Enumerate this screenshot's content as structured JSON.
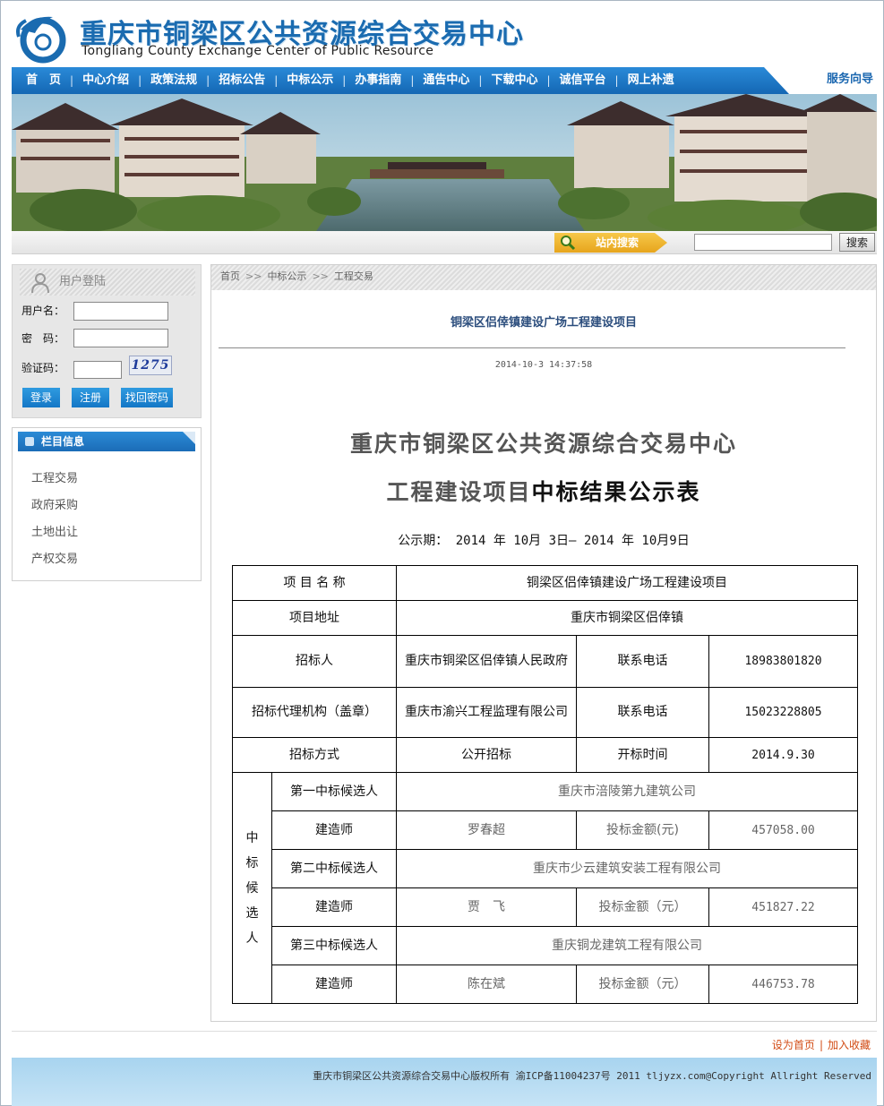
{
  "header": {
    "title": "重庆市铜梁区公共资源综合交易中心",
    "subtitle": "Tongliang County Exchange Center of Public Resource"
  },
  "nav": {
    "items": [
      "首　页",
      "中心介绍",
      "政策法规",
      "招标公告",
      "中标公示",
      "办事指南",
      "通告中心",
      "下载中心",
      "诚信平台",
      "网上补遗"
    ],
    "service": "服务向导"
  },
  "search": {
    "tag_label": "站内搜索",
    "placeholder": "",
    "button": "搜索"
  },
  "login": {
    "title": "用户登陆",
    "username_label": "用户名：",
    "password_label": "密　码：",
    "captcha_label": "验证码：",
    "captcha_value": "1275",
    "login_btn": "登录",
    "register_btn": "注册",
    "recover_btn": "找回密码"
  },
  "column_info": {
    "title": "栏目信息",
    "items": [
      "工程交易",
      "政府采购",
      "土地出让",
      "产权交易"
    ]
  },
  "breadcrumb": [
    "首页",
    "中标公示",
    "工程交易"
  ],
  "article": {
    "title": "铜梁区侣倖镇建设广场工程建设项目",
    "date": "2014-10-3 14:37:58",
    "doc_title1": "重庆市铜梁区公共资源综合交易中心",
    "doc_title2a": "工程建设项目",
    "doc_title2b": "中标结果公示表",
    "period": "公示期：  2014 年 10月 3日—  2014 年 10月9日"
  },
  "table": {
    "project_name_label": "项 目 名 称",
    "project_name": "铜梁区侣倖镇建设广场工程建设项目",
    "address_label": "项目地址",
    "address": "重庆市铜梁区侣倖镇",
    "tenderer_label": "招标人",
    "tenderer": "重庆市铜梁区侣倖镇人民政府",
    "phone_label": "联系电话",
    "tenderer_phone": "18983801820",
    "agency_label": "招标代理机构（盖章）",
    "agency": "重庆市渝兴工程监理有限公司",
    "agency_phone": "15023228805",
    "method_label": "招标方式",
    "method": "公开招标",
    "open_time_label": "开标时间",
    "open_time": "2014.9.30",
    "candidates_label_chars": [
      "中",
      "标",
      "候",
      "选",
      "人"
    ],
    "candidates": [
      {
        "rank_label": "第一中标候选人",
        "company": "重庆市涪陵第九建筑公司",
        "builder_label": "建造师",
        "builder": "罗春超",
        "amount_label": "投标金额(元)",
        "amount": "457058.00"
      },
      {
        "rank_label": "第二中标候选人",
        "company": "重庆市少云建筑安装工程有限公司",
        "builder_label": "建造师",
        "builder": "贾　飞",
        "amount_label": "投标金额（元）",
        "amount": "451827.22"
      },
      {
        "rank_label": "第三中标候选人",
        "company": "重庆铜龙建筑工程有限公司",
        "builder_label": "建造师",
        "builder": "陈在斌",
        "amount_label": "投标金额（元）",
        "amount": "446753.78"
      }
    ]
  },
  "footer": {
    "set_home": "设为首页",
    "sep": "|",
    "add_fav": "加入收藏",
    "copyright": "重庆市铜梁区公共资源综合交易中心版权所有 渝ICP备11004237号 2011 tljyzx.com@Copyright Allright Reserved"
  },
  "colors": {
    "brand_blue": "#1a6bb0",
    "nav_blue": "#1b72bf",
    "footer_link": "#d24b14"
  }
}
